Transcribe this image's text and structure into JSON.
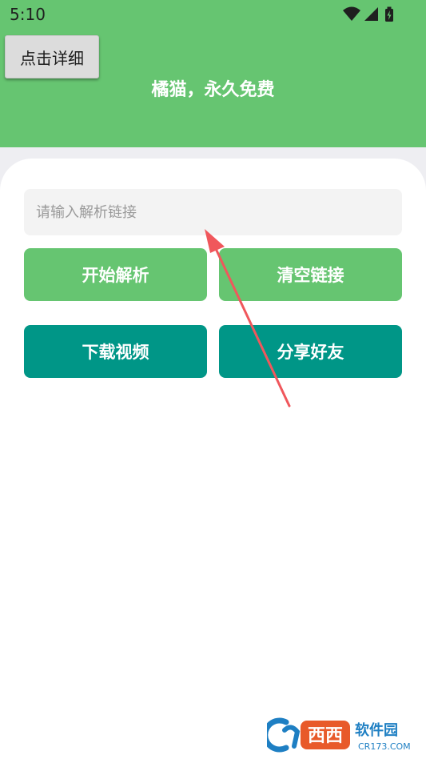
{
  "status_bar": {
    "time": "5:10",
    "icons": [
      "wifi-icon",
      "signal-icon",
      "battery-icon"
    ]
  },
  "header": {
    "detail_button_label": "点击详细",
    "title": "橘猫，永久免费",
    "background_color": "#66c571"
  },
  "form": {
    "input_placeholder": "请输入解析链接",
    "input_value": ""
  },
  "buttons": {
    "parse": "开始解析",
    "clear": "清空链接",
    "download": "下载视频",
    "share": "分享好友"
  },
  "colors": {
    "primary_green": "#66c571",
    "teal": "#009687",
    "annotation_arrow": "#f0575c"
  },
  "watermark": {
    "brand": "西西",
    "suffix": "软件园",
    "site": "CR173.COM"
  }
}
